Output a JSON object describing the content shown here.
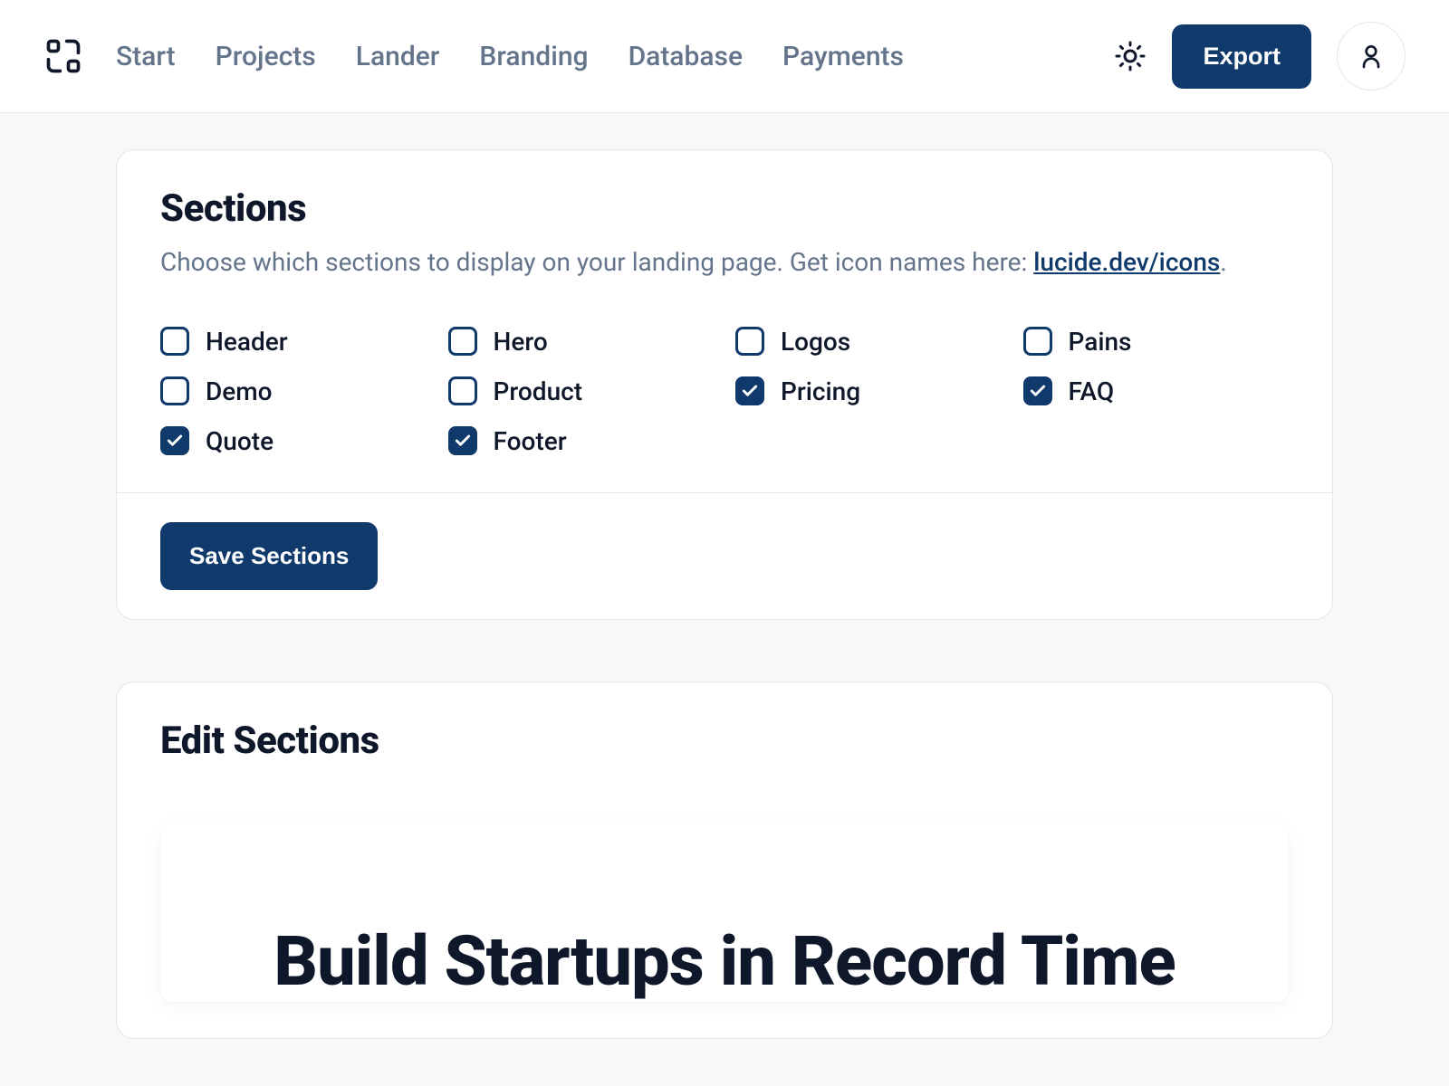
{
  "nav": {
    "items": [
      {
        "label": "Start"
      },
      {
        "label": "Projects"
      },
      {
        "label": "Lander"
      },
      {
        "label": "Branding"
      },
      {
        "label": "Database"
      },
      {
        "label": "Payments"
      }
    ]
  },
  "header": {
    "export_label": "Export"
  },
  "sections_card": {
    "title": "Sections",
    "description_prefix": "Choose which sections to display on your landing page. Get icon names here: ",
    "link_text": "lucide.dev/icons",
    "description_suffix": ".",
    "items": [
      {
        "label": "Header",
        "checked": false
      },
      {
        "label": "Hero",
        "checked": false
      },
      {
        "label": "Logos",
        "checked": false
      },
      {
        "label": "Pains",
        "checked": false
      },
      {
        "label": "Demo",
        "checked": false
      },
      {
        "label": "Product",
        "checked": false
      },
      {
        "label": "Pricing",
        "checked": true
      },
      {
        "label": "FAQ",
        "checked": true
      },
      {
        "label": "Quote",
        "checked": true
      },
      {
        "label": "Footer",
        "checked": true
      }
    ],
    "save_label": "Save Sections"
  },
  "edit_card": {
    "title": "Edit Sections",
    "hero_title": "Build Startups in Record Time"
  }
}
